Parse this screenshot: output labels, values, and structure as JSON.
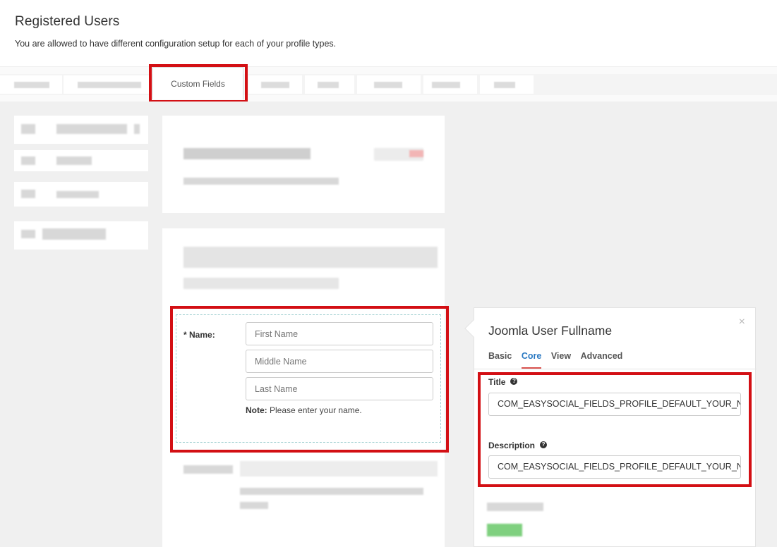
{
  "header": {
    "title": "Registered Users",
    "description": "You are allowed to have different configuration setup for each of your profile types."
  },
  "tabs": {
    "active_label": "Custom Fields"
  },
  "name_field": {
    "label": "Name:",
    "required_mark": "*",
    "first_placeholder": "First Name",
    "middle_placeholder": "Middle Name",
    "last_placeholder": "Last Name",
    "note_prefix": "Note:",
    "note_text": "Please enter your name."
  },
  "config": {
    "title": "Joomla User Fullname",
    "close": "×",
    "tabs": [
      "Basic",
      "Core",
      "View",
      "Advanced"
    ],
    "active_tab": "Core",
    "title_label": "Title",
    "title_value": "COM_EASYSOCIAL_FIELDS_PROFILE_DEFAULT_YOUR_NAME",
    "description_label": "Description",
    "description_value": "COM_EASYSOCIAL_FIELDS_PROFILE_DEFAULT_YOUR_NAME_DESC",
    "help_icon": "?"
  },
  "colors": {
    "highlight": "#d30f14",
    "active_tab_text": "#2b79c2",
    "active_tab_underline": "#d9534f"
  }
}
